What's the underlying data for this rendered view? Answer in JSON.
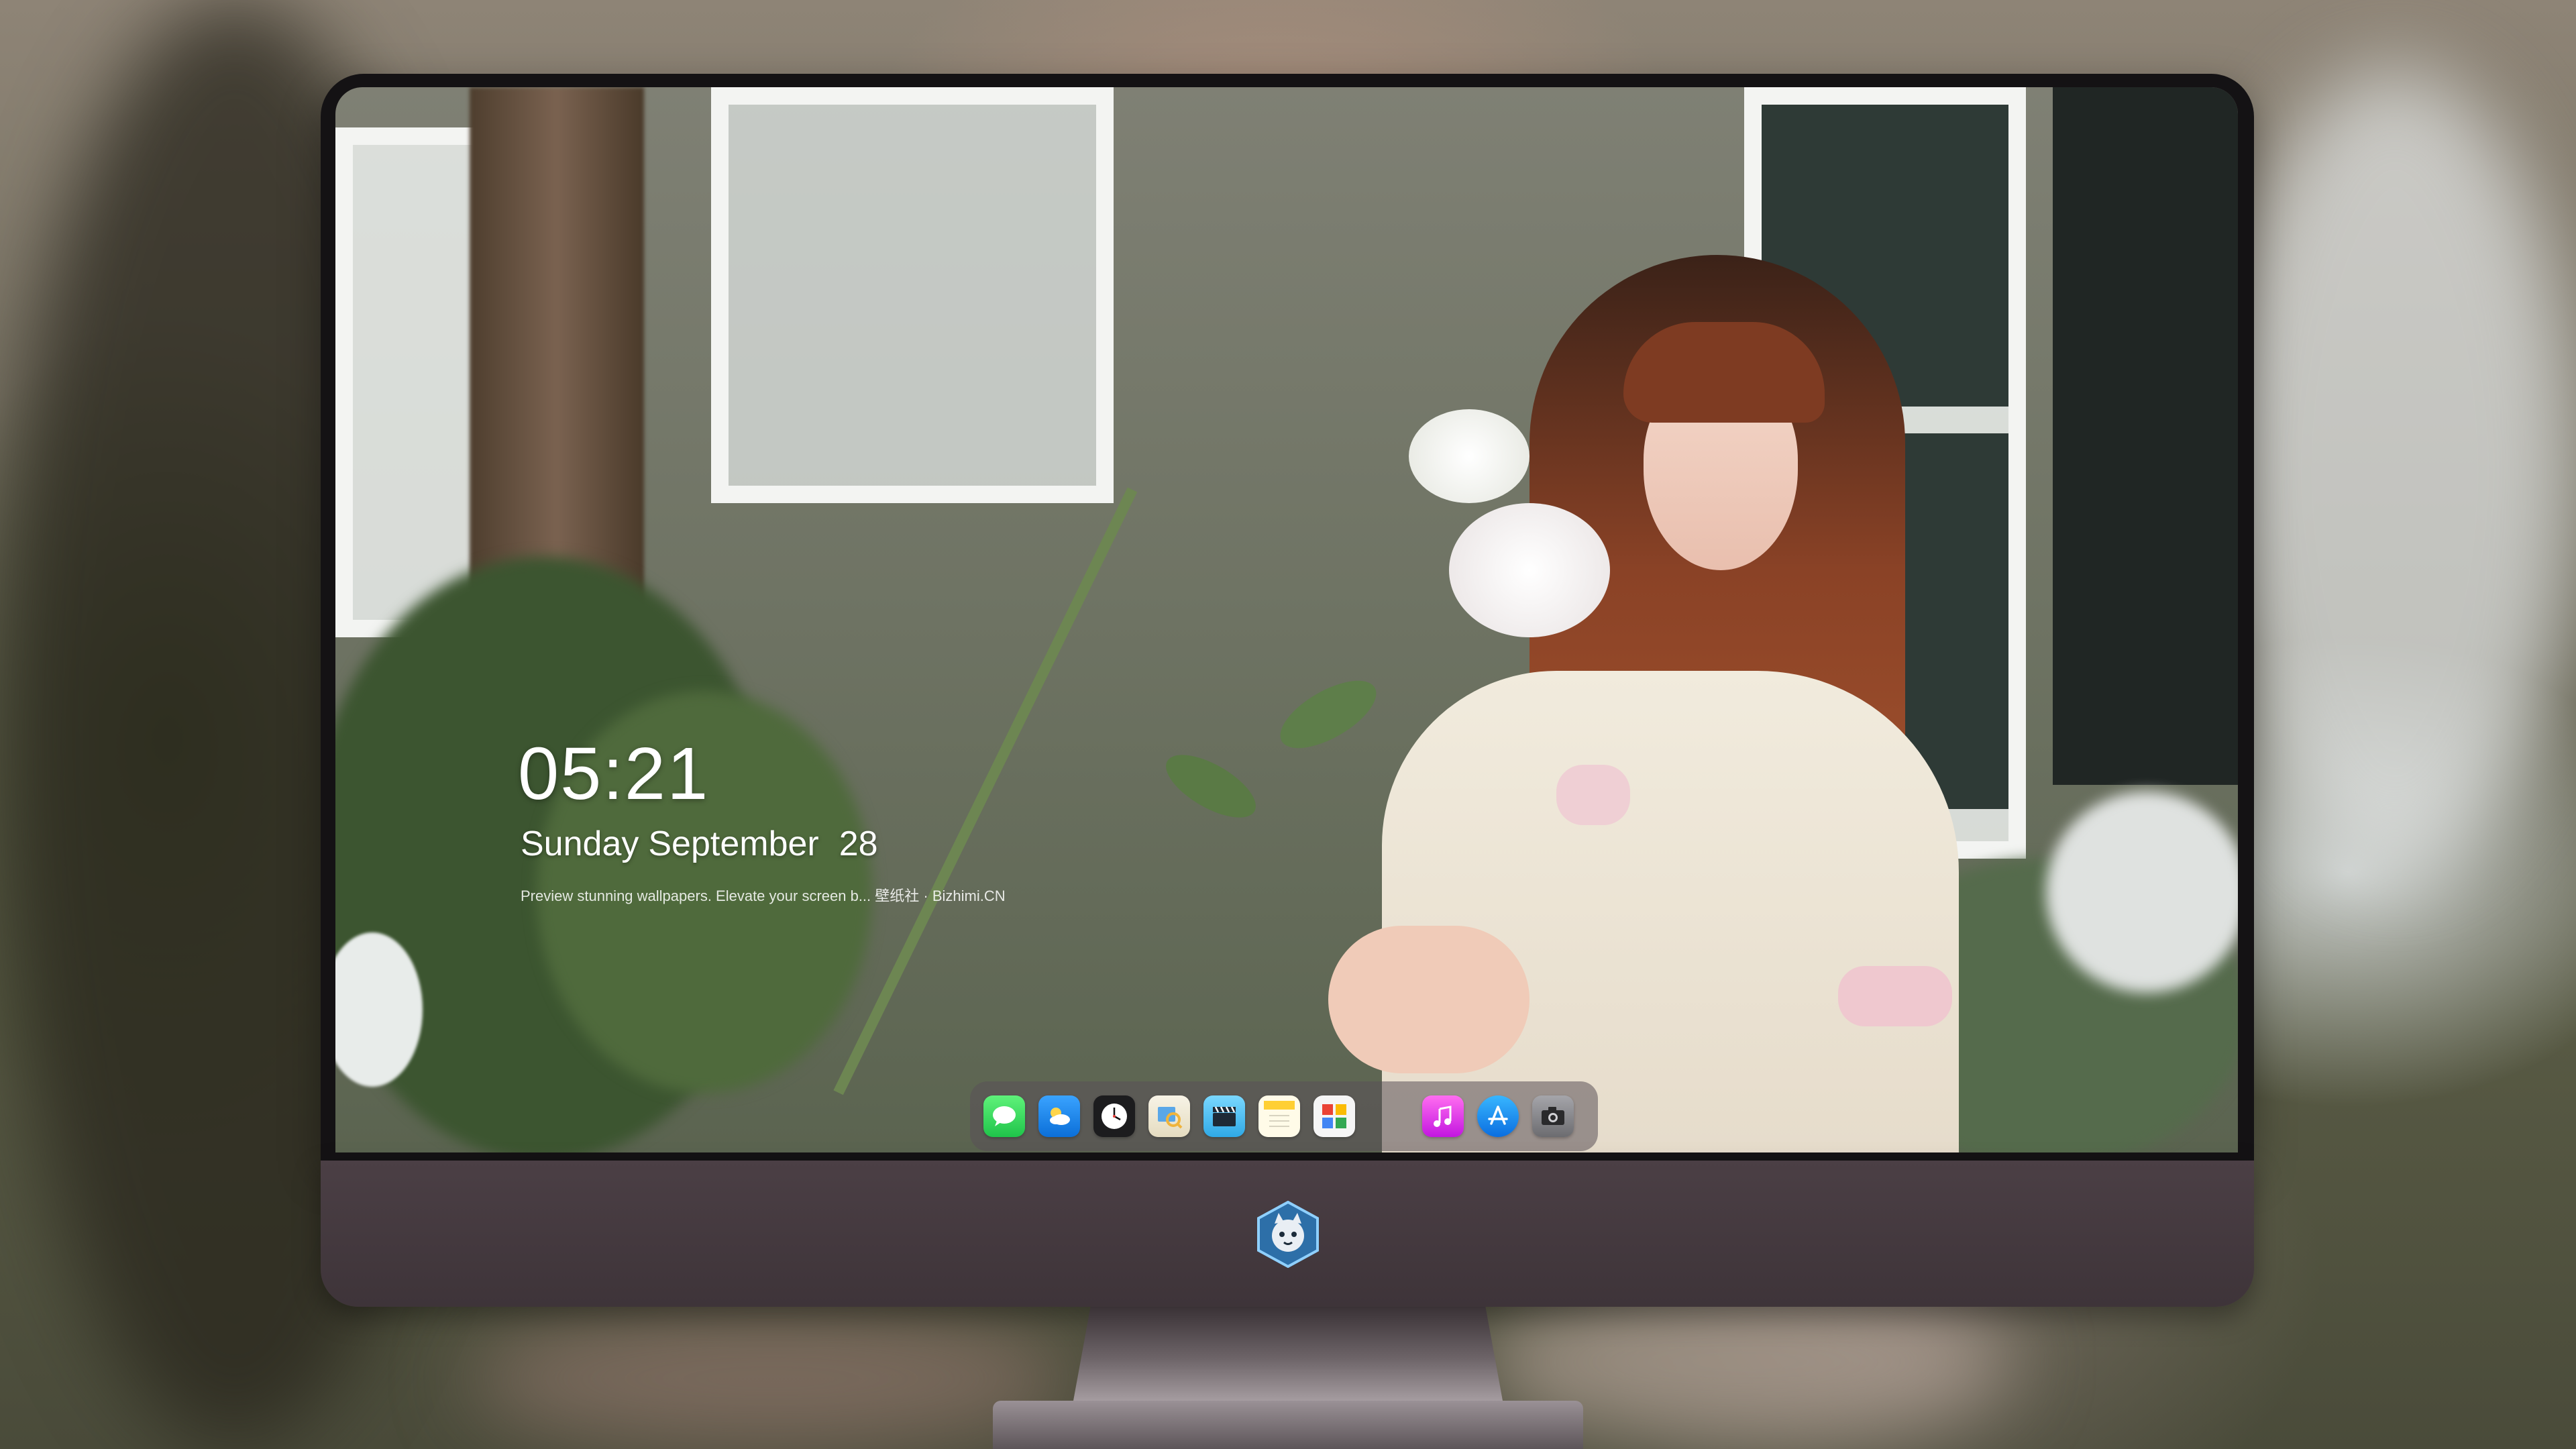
{
  "lock_screen": {
    "time": "05:21",
    "date": {
      "weekday": "Sunday",
      "month": "September",
      "day": "28"
    },
    "tagline": "Preview stunning wallpapers. Elevate your screen b... 壁纸社 · Bizhimi.CN"
  },
  "dock": {
    "apps": [
      {
        "name": "Messages",
        "icon": "messages-icon",
        "color": "#2fd158"
      },
      {
        "name": "Weather",
        "icon": "weather-icon",
        "color": "#1e8ef0"
      },
      {
        "name": "Clock",
        "icon": "clock-icon",
        "color": "#ffffff"
      },
      {
        "name": "Preview",
        "icon": "preview-icon",
        "color": "#f2c94c"
      },
      {
        "name": "Clips",
        "icon": "clapper-icon",
        "color": "#5ac8fa"
      },
      {
        "name": "Notes",
        "icon": "notes-icon",
        "color": "#ffd54a"
      },
      {
        "name": "Photo Booth",
        "icon": "photo-collage-icon",
        "color": "#34a853"
      },
      {
        "name": "Music",
        "icon": "music-icon",
        "color": "#e040fb"
      },
      {
        "name": "App Store",
        "icon": "app-store-icon",
        "color": "#1a8cff"
      },
      {
        "name": "Camera",
        "icon": "camera-icon",
        "color": "#8e8e93"
      }
    ]
  },
  "monitor": {
    "chin_logo": "mascot-logo"
  }
}
